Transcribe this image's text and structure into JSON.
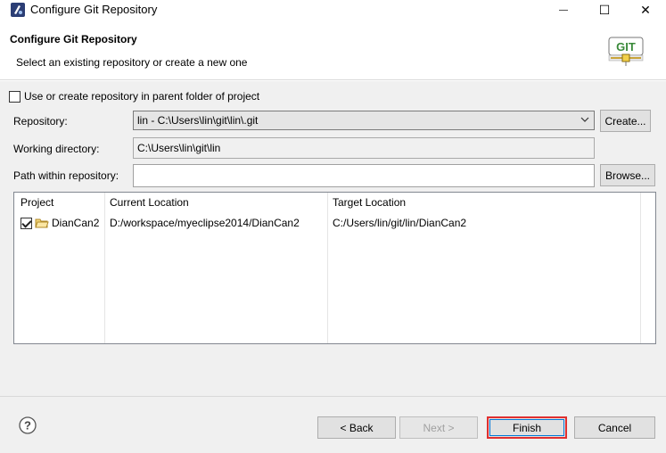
{
  "window": {
    "title": "Configure Git Repository",
    "minimize_glyph": "—",
    "maximize_glyph": "☐",
    "close_glyph": "✕",
    "app_icon": "eclipse-icon"
  },
  "banner": {
    "heading": "Configure Git Repository",
    "description": "Select an existing repository or create a new one",
    "logo_text": "GIT"
  },
  "form": {
    "parent_folder_checkbox_label": "Use or create repository in parent folder of project",
    "parent_folder_checked": false,
    "repository_label": "Repository:",
    "repository_value": "lin - C:\\Users\\lin\\git\\lin\\.git",
    "create_button": "Create...",
    "working_dir_label": "Working directory:",
    "working_dir_value": "C:\\Users\\lin\\git\\lin",
    "path_label": "Path within repository:",
    "path_value": "",
    "browse_button": "Browse..."
  },
  "table": {
    "columns": [
      "Project",
      "Current Location",
      "Target Location"
    ],
    "rows": [
      {
        "checked": true,
        "project": "DianCan2",
        "current": "D:/workspace/myeclipse2014/DianCan2",
        "target": "C:/Users/lin/git/lin/DianCan2"
      }
    ]
  },
  "footer": {
    "help_icon": "help-icon",
    "back_button": "< Back",
    "next_button": "Next >",
    "finish_button": "Finish",
    "cancel_button": "Cancel"
  },
  "colors": {
    "accent_outline": "#e03030",
    "focus": "#0078d7",
    "dialog_bg": "#f0f0f0"
  }
}
